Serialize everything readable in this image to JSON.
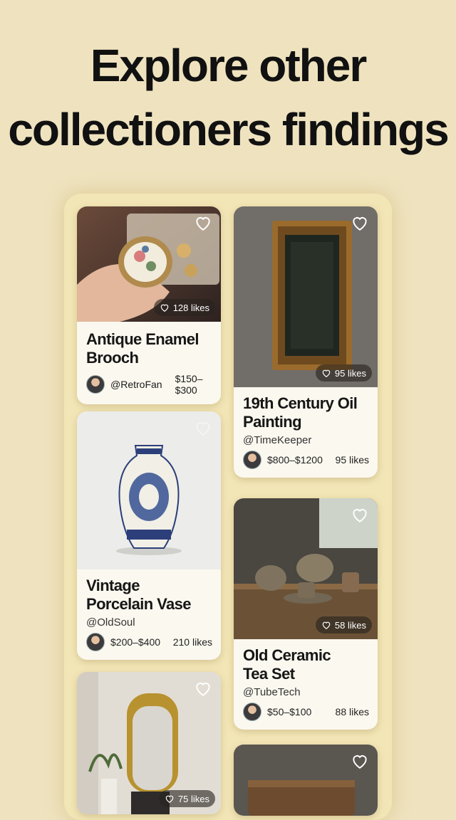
{
  "headline": {
    "line1": "Explore other",
    "line2": "collectioners findings"
  },
  "cards": [
    {
      "title": "Antique Enamel Brooch",
      "user": "@RetroFan",
      "price": "$150–$300",
      "likes_pill": "128 likes"
    },
    {
      "title": "19th Century Oil Painting",
      "user": "@TimeKeeper",
      "price": "$800–$1200",
      "likes": "95 likes",
      "likes_pill": "95 likes"
    },
    {
      "title": "Vintage Porcelain Vase",
      "user": "@OldSoul",
      "price": "$200–$400",
      "likes": "210 likes"
    },
    {
      "title": "Old Ceramic Tea Set",
      "user": "@TubeTech",
      "price": "$50–$100",
      "likes": "88 likes",
      "likes_pill": "58 likes"
    },
    {
      "likes_pill": "75 likes"
    }
  ],
  "icons": {
    "heart": "heart-icon",
    "avatar": "user-avatar"
  },
  "colors": {
    "background": "#efe3bf",
    "card": "#fbf8ef",
    "panel": "#f3e6b6",
    "pill": "#3a332c"
  }
}
